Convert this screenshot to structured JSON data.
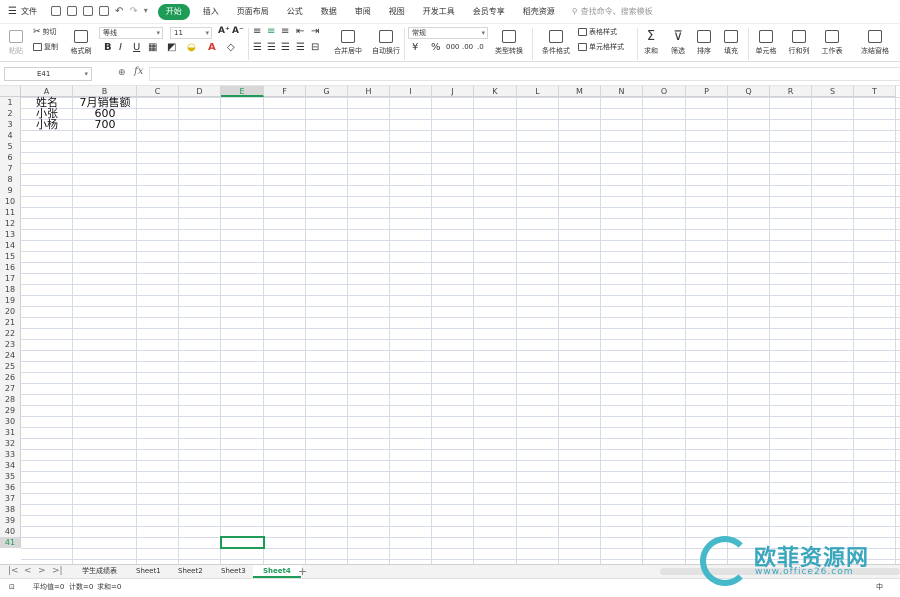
{
  "menubar": {
    "file_label": "文件",
    "tabs": [
      "开始",
      "插入",
      "页面布局",
      "公式",
      "数据",
      "审阅",
      "视图",
      "开发工具",
      "会员专享",
      "稻壳资源"
    ],
    "active_tab": "开始",
    "search_placeholder": "查找命令、搜索模板"
  },
  "ribbon": {
    "paste": "粘贴",
    "cut": "剪切",
    "copy": "复制",
    "format_painter": "格式刷",
    "font_name": "等线",
    "font_size": "11",
    "merge_center": "合并居中",
    "wrap_text": "自动换行",
    "number_format": "常规",
    "type_convert": "类型转换",
    "cond_format": "条件格式",
    "table_style": "表格样式",
    "cell_style": "单元格样式",
    "sum": "求和",
    "filter": "筛选",
    "sort": "排序",
    "fill": "填充",
    "cell": "单元格",
    "row_col": "行和列",
    "worksheet": "工作表",
    "freeze": "冻结窗格"
  },
  "formula_bar": {
    "name_box": "E41",
    "fx": "fx",
    "formula": ""
  },
  "grid": {
    "columns": [
      "A",
      "B",
      "C",
      "D",
      "E",
      "F",
      "G",
      "H",
      "I",
      "J",
      "K",
      "L",
      "M",
      "N",
      "O",
      "P",
      "Q",
      "R",
      "S",
      "T"
    ],
    "selected_column": "E",
    "selected_row": 41,
    "row_count": 41,
    "cells": [
      {
        "ref": "A1",
        "value": "姓名"
      },
      {
        "ref": "B1",
        "value": "7月销售额"
      },
      {
        "ref": "A2",
        "value": "小张"
      },
      {
        "ref": "B2",
        "value": "600"
      },
      {
        "ref": "A3",
        "value": "小杨"
      },
      {
        "ref": "B3",
        "value": "700"
      }
    ]
  },
  "sheets": {
    "tabs": [
      "学生成绩表",
      "Sheet1",
      "Sheet2",
      "Sheet3",
      "Sheet4"
    ],
    "active": "Sheet4",
    "add_label": "+"
  },
  "status": {
    "average": "平均值=0",
    "count": "计数=0",
    "sum": "求和=0",
    "right": "中"
  },
  "watermark": {
    "title": "欧菲资源网",
    "url": "www.office26.com"
  },
  "colors": {
    "accent": "#1e9b57",
    "gridline": "#d6dbe8",
    "watermark": "#3aa6bd"
  }
}
